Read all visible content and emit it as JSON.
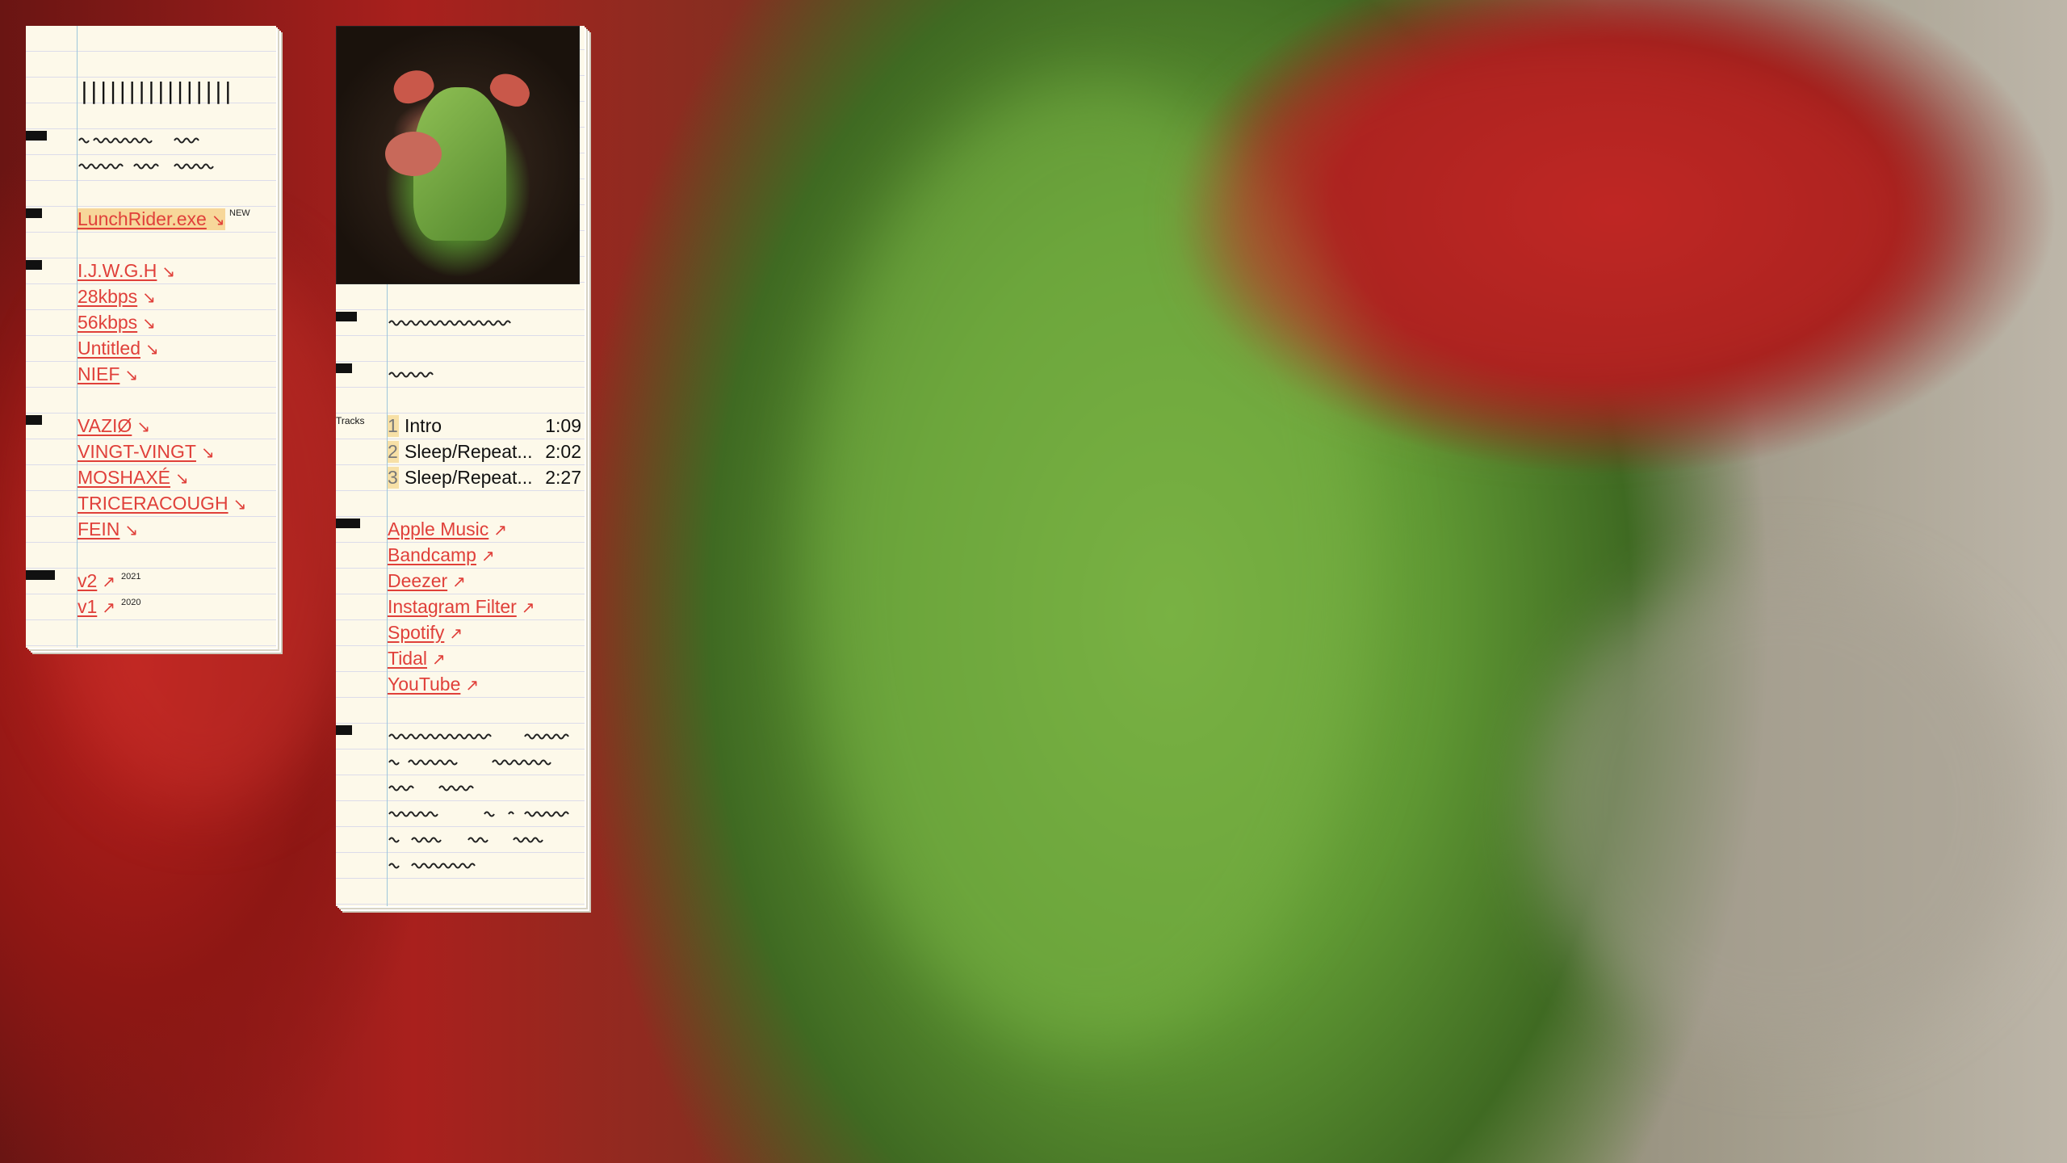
{
  "left_note": {
    "header_glyph": "||||||||||||||||",
    "featured": {
      "label": "LunchRider.exe",
      "arrow": "↘",
      "badge": "NEW"
    },
    "group_a": [
      {
        "label": "I.J.W.G.H",
        "arrow": "↘"
      },
      {
        "label": "28kbps",
        "arrow": "↘"
      },
      {
        "label": "56kbps",
        "arrow": "↘"
      },
      {
        "label": "Untitled",
        "arrow": "↘"
      },
      {
        "label": "NIEF",
        "arrow": "↘"
      }
    ],
    "group_b": [
      {
        "label": "VAZIØ",
        "arrow": "↘"
      },
      {
        "label": "VINGT-VINGT",
        "arrow": "↘"
      },
      {
        "label": "MOSHAXÉ",
        "arrow": "↘"
      },
      {
        "label": "TRICERACOUGH",
        "arrow": "↘"
      },
      {
        "label": "FEIN",
        "arrow": "↘"
      }
    ],
    "versions": [
      {
        "label": "v2",
        "arrow": "↗",
        "year": "2021"
      },
      {
        "label": "v1",
        "arrow": "↗",
        "year": "2020"
      }
    ]
  },
  "right_note": {
    "cover_icon": "green-pig-mask-artwork",
    "tracks_label": "Tracks",
    "tracks": [
      {
        "num": "1",
        "title": "Intro",
        "duration": "1:09"
      },
      {
        "num": "2",
        "title": "Sleep/Repeat...",
        "duration": "2:02"
      },
      {
        "num": "3",
        "title": "Sleep/Repeat...",
        "duration": "2:27"
      }
    ],
    "links": [
      {
        "label": "Apple Music",
        "arrow": "↗"
      },
      {
        "label": "Bandcamp",
        "arrow": "↗"
      },
      {
        "label": "Deezer",
        "arrow": "↗"
      },
      {
        "label": "Instagram Filter",
        "arrow": "↗"
      },
      {
        "label": "Spotify",
        "arrow": "↗"
      },
      {
        "label": "Tidal",
        "arrow": "↗"
      },
      {
        "label": "YouTube",
        "arrow": "↗"
      }
    ]
  },
  "colors": {
    "link": "#e0403a",
    "paper": "#fdf9ea",
    "highlight": "#f7d79a",
    "margin_line": "#9ec7da"
  }
}
